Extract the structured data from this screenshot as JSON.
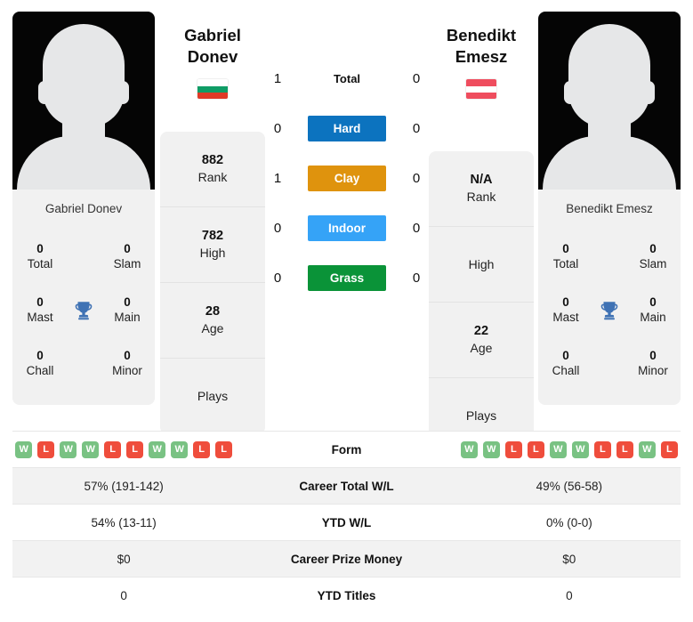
{
  "players": {
    "left": {
      "first_name": "Gabriel",
      "last_name": "Donev",
      "full_name": "Gabriel Donev",
      "flag_name": "bulgaria-flag",
      "flag_colors": [
        "#ffffff",
        "#0f9d66",
        "#e03a27"
      ],
      "rank": "882",
      "rank_label": "Rank",
      "high": "782",
      "high_label": "High",
      "age": "28",
      "age_label": "Age",
      "plays_label": "Plays",
      "plays_value": "",
      "titles": {
        "total": "0",
        "total_label": "Total",
        "slam": "0",
        "slam_label": "Slam",
        "mast": "0",
        "mast_label": "Mast",
        "main": "0",
        "main_label": "Main",
        "chall": "0",
        "chall_label": "Chall",
        "minor": "0",
        "minor_label": "Minor"
      },
      "form": [
        "W",
        "L",
        "W",
        "W",
        "L",
        "L",
        "W",
        "W",
        "L",
        "L"
      ],
      "career_wl": "57% (191-142)",
      "ytd_wl": "54% (13-11)",
      "career_prize": "$0",
      "ytd_titles": "0"
    },
    "right": {
      "first_name": "Benedikt",
      "last_name": "Emesz",
      "full_name": "Benedikt Emesz",
      "flag_name": "austria-flag",
      "flag_colors": [
        "#ef4d5e",
        "#ffffff",
        "#ef4d5e"
      ],
      "rank": "N/A",
      "rank_label": "Rank",
      "high": "",
      "high_label": "High",
      "age": "22",
      "age_label": "Age",
      "plays_label": "Plays",
      "plays_value": "",
      "titles": {
        "total": "0",
        "total_label": "Total",
        "slam": "0",
        "slam_label": "Slam",
        "mast": "0",
        "mast_label": "Mast",
        "main": "0",
        "main_label": "Main",
        "chall": "0",
        "chall_label": "Chall",
        "minor": "0",
        "minor_label": "Minor"
      },
      "form": [
        "W",
        "W",
        "L",
        "L",
        "W",
        "W",
        "L",
        "L",
        "W",
        "L"
      ],
      "career_wl": "49% (56-58)",
      "ytd_wl": "0% (0-0)",
      "career_prize": "$0",
      "ytd_titles": "0"
    }
  },
  "head_to_head": {
    "rows": [
      {
        "left": "1",
        "label": "Total",
        "right": "0",
        "style": "plain",
        "color": ""
      },
      {
        "left": "0",
        "label": "Hard",
        "right": "0",
        "style": "badge",
        "color": "#0c73bf"
      },
      {
        "left": "1",
        "label": "Clay",
        "right": "0",
        "style": "badge",
        "color": "#df930d"
      },
      {
        "left": "0",
        "label": "Indoor",
        "right": "0",
        "style": "badge",
        "color": "#35a3f7"
      },
      {
        "left": "0",
        "label": "Grass",
        "right": "0",
        "style": "badge",
        "color": "#0a9338"
      }
    ]
  },
  "comparison": {
    "rows": [
      {
        "label": "Form",
        "key": "form",
        "type": "form"
      },
      {
        "label": "Career Total W/L",
        "key": "career_wl",
        "type": "text"
      },
      {
        "label": "YTD W/L",
        "key": "ytd_wl",
        "type": "text"
      },
      {
        "label": "Career Prize Money",
        "key": "career_prize",
        "type": "text"
      },
      {
        "label": "YTD Titles",
        "key": "ytd_titles",
        "type": "text"
      }
    ]
  },
  "icons": {
    "trophy": "trophy-icon",
    "trophy_color": "#3f72b4"
  }
}
